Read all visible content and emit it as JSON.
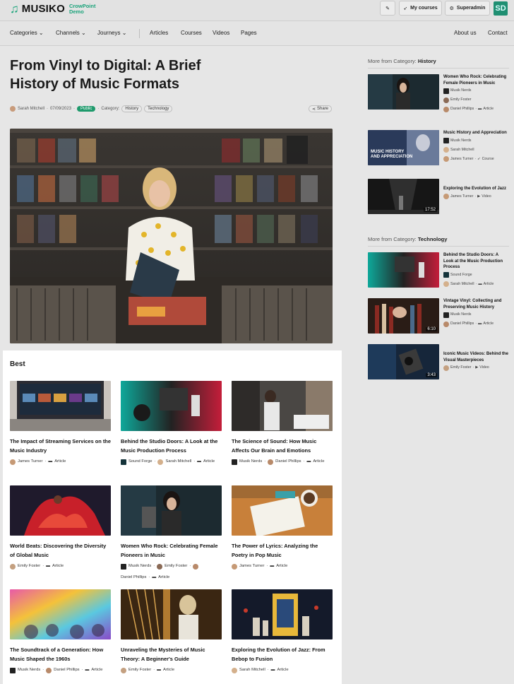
{
  "topbar": {
    "brand": "MUSIKO",
    "brand_sub1": "CrowPoint",
    "brand_sub2": "Demo",
    "my_courses": "My courses",
    "superadmin": "Superadmin",
    "avatar_initials": "SD"
  },
  "nav": {
    "categories": "Categories",
    "channels": "Channels",
    "journeys": "Journeys",
    "articles": "Articles",
    "courses": "Courses",
    "videos": "Videos",
    "pages": "Pages",
    "about": "About us",
    "contact": "Contact"
  },
  "article": {
    "title": "From Vinyl to Digital: A Brief History of Music Formats",
    "author": "Sarah Mitchell",
    "date": "07/09/2023",
    "status": "Public",
    "category_label": "Category:",
    "categories": [
      "History",
      "Technology"
    ],
    "share": "Share"
  },
  "best": {
    "heading": "Best",
    "cards": [
      {
        "title": "The Impact of Streaming Services on the Music Industry",
        "meta": [
          "James Turner",
          "Article"
        ]
      },
      {
        "title": "Behind the Studio Doors: A Look at the Music Production Process",
        "meta": [
          "Sound Forge",
          "Sarah Mitchell",
          "Article"
        ]
      },
      {
        "title": "The Science of Sound: How Music Affects Our Brain and Emotions",
        "meta": [
          "Musik Nerds",
          "Daniel Phillips",
          "Article"
        ]
      },
      {
        "title": "World Beats: Discovering the Diversity of Global Music",
        "meta": [
          "Emily Foster",
          "Article"
        ]
      },
      {
        "title": "Women Who Rock: Celebrating Female Pioneers in Music",
        "meta": [
          "Musik Nerds",
          "Emily Foster",
          "Daniel Phillips",
          "Article"
        ]
      },
      {
        "title": "The Power of Lyrics: Analyzing the Poetry in Pop Music",
        "meta": [
          "James Turner",
          "Article"
        ]
      },
      {
        "title": "The Soundtrack of a Generation: How Music Shaped the 1960s",
        "meta": [
          "Musik Nerds",
          "Daniel Phillips",
          "Article"
        ]
      },
      {
        "title": "Unraveling the Mysteries of Music Theory: A Beginner's Guide",
        "meta": [
          "Emily Foster",
          "Article"
        ]
      },
      {
        "title": "Exploring the Evolution of Jazz: From Bebop to Fusion",
        "meta": [
          "Sarah Mitchell",
          "Article"
        ]
      }
    ]
  },
  "sidebar": {
    "history": {
      "prefix": "More from Category:",
      "name": "History",
      "items": [
        {
          "title": "Women Who Rock: Celebrating Female Pioneers in Music",
          "meta": [
            "Musik Nerds",
            "Emily Foster",
            "Daniel Phillips",
            "Article"
          ],
          "duration": ""
        },
        {
          "title": "Music History and Appreciation",
          "meta": [
            "Musik Nerds",
            "Sarah Mitchell",
            "James Turner",
            "Course"
          ],
          "duration": "",
          "overlay": "MUSIC HISTORY AND APPRECIATION"
        },
        {
          "title": "Exploring the Evolution of Jazz",
          "meta": [
            "James Turner",
            "Video"
          ],
          "duration": "17:52"
        }
      ]
    },
    "technology": {
      "prefix": "More from Category:",
      "name": "Technology",
      "items": [
        {
          "title": "Behind the Studio Doors: A Look at the Music Production Process",
          "meta": [
            "Sound Forge",
            "Sarah Mitchell",
            "Article"
          ],
          "duration": ""
        },
        {
          "title": "Vintage Vinyl: Collecting and Preserving Music History",
          "meta": [
            "Musik Nerds",
            "Daniel Phillips",
            "Article"
          ],
          "duration": "6:10"
        },
        {
          "title": "Iconic Music Videos: Behind the Visual Masterpieces",
          "meta": [
            "Emily Foster",
            "Video"
          ],
          "duration": "3:43"
        }
      ]
    }
  },
  "colors": {
    "accent": "#1aa37a",
    "public_badge": "#1f9a6c"
  }
}
